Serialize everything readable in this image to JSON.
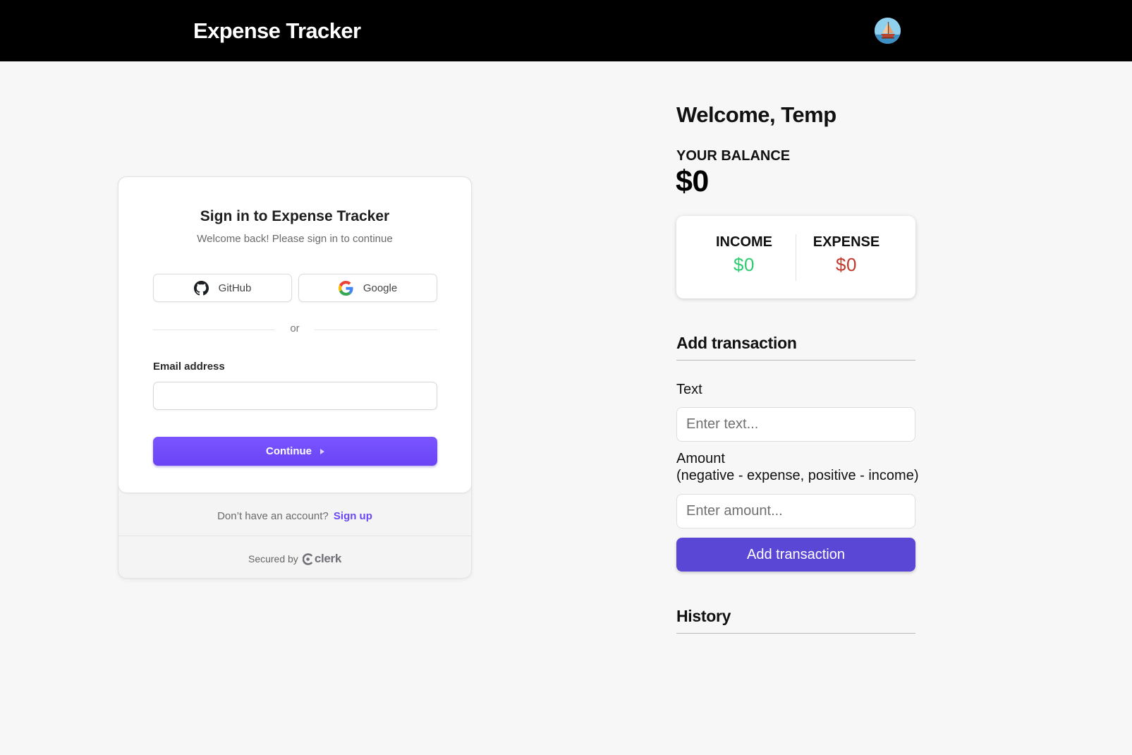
{
  "header": {
    "title": "Expense Tracker",
    "avatar_icon": "sailboat-avatar-icon"
  },
  "signin": {
    "title": "Sign in to Expense Tracker",
    "subtitle": "Welcome back! Please sign in to continue",
    "github_label": "GitHub",
    "google_label": "Google",
    "divider_text": "or",
    "email_label": "Email address",
    "email_value": "",
    "continue_label": "Continue",
    "no_account_text": "Don’t have an account?",
    "signup_label": "Sign up",
    "secured_by_text": "Secured by",
    "clerk_brand": "clerk",
    "accent_color": "#6c47ff"
  },
  "tracker": {
    "welcome": "Welcome, Temp",
    "balance_label": "YOUR BALANCE",
    "balance_value": "$0",
    "income_label": "INCOME",
    "income_value": "$0",
    "expense_label": "EXPENSE",
    "expense_value": "$0",
    "income_color": "#2ecc71",
    "expense_color": "#c0392b",
    "add_section_title": "Add transaction",
    "text_label": "Text",
    "text_placeholder": "Enter text...",
    "amount_label_line1": "Amount",
    "amount_label_line2": "(negative - expense, positive - income)",
    "amount_placeholder": "Enter amount...",
    "add_button_label": "Add transaction",
    "history_title": "History"
  }
}
